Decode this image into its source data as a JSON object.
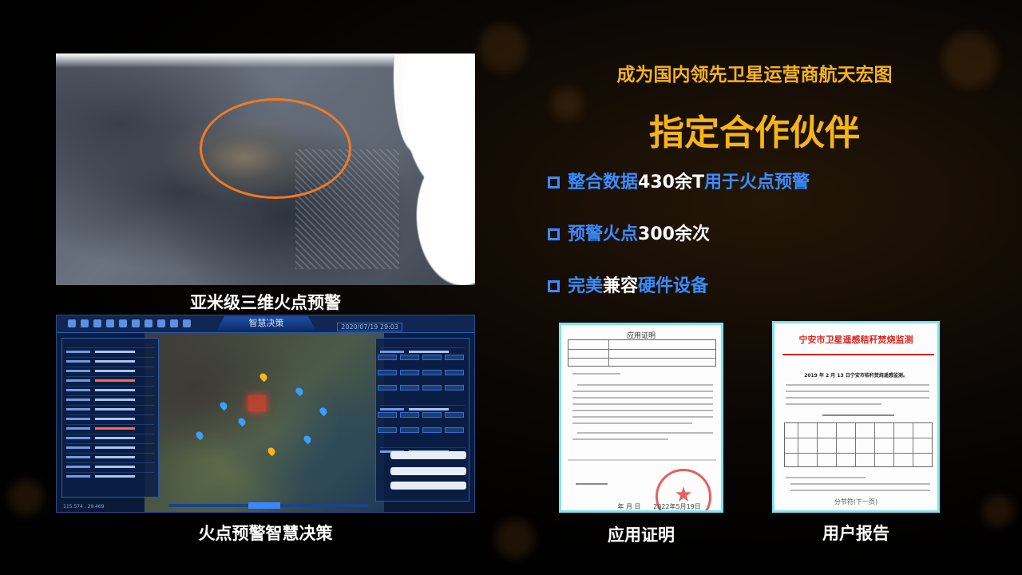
{
  "headline": {
    "line1": "成为国内领先卫星运营商航天宏图",
    "line2": "指定合作伙伴"
  },
  "bullets": [
    {
      "blue_a": "整合数据",
      "white": "430余T",
      "blue_b": "用于火点预警"
    },
    {
      "blue_a": "预警火点",
      "white": "300余次",
      "blue_b": ""
    },
    {
      "blue_a": "完美",
      "white": "兼容",
      "blue_b": "硬件设备"
    }
  ],
  "captions": {
    "map3d": "亚米级三维火点预警",
    "dashboard": "火点预警智慧决策",
    "doc1": "应用证明",
    "doc2": "用户报告"
  },
  "dashboard": {
    "title": "智慧决策",
    "time": "2020/07/19  29:03",
    "coords": "115.574 , 29.469"
  },
  "doc1": {
    "title": "应用证明",
    "date": "2022年5月19日",
    "footer": "年  月  日"
  },
  "doc2": {
    "title": "宁安市卫星遥感秸秆焚烧监测",
    "subtitle": "2019 年 2 月 13 日宁安市秸秆焚烧遥感监测。",
    "footer": "分节符(下一页)"
  },
  "colors": {
    "accent_gold": "#f5b418",
    "accent_blue": "#3b8cff",
    "ring_orange": "#ef7a24",
    "doc_border": "#7fe3f0"
  }
}
